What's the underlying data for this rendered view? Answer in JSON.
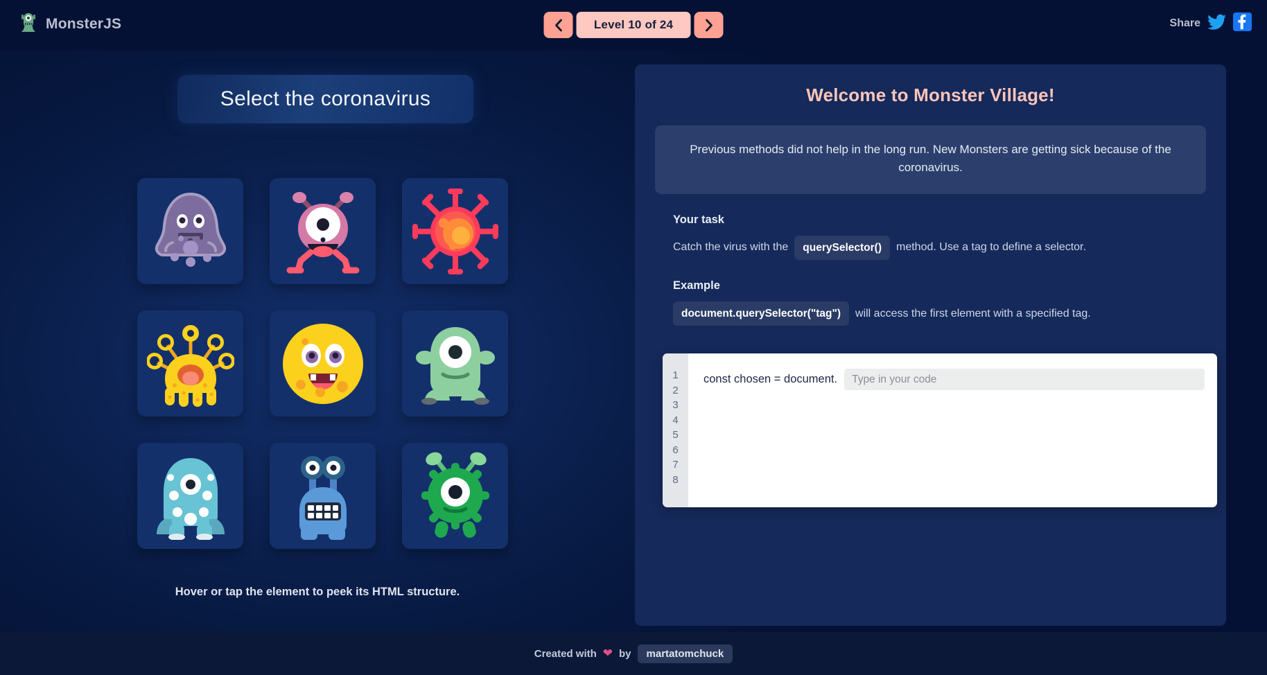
{
  "header": {
    "logo_text": "MonsterJS",
    "logo_icon": "monster-icon",
    "nav": {
      "prev_icon": "chevron-left-icon",
      "next_icon": "chevron-right-icon",
      "level_label": "Level 10 of 24",
      "current_level": 10,
      "total_levels": 24
    },
    "share": {
      "label": "Share",
      "twitter_icon": "twitter-icon",
      "facebook_icon": "facebook-icon"
    }
  },
  "left": {
    "task_title": "Select the coronavirus",
    "hint": "Hover or tap the element to peek its HTML structure.",
    "monsters": [
      {
        "name": "purple-blob-monster",
        "type": "monster"
      },
      {
        "name": "pink-cyclops-monster",
        "type": "monster"
      },
      {
        "name": "coronavirus",
        "type": "virus"
      },
      {
        "name": "yellow-stalk-eyes-monster",
        "type": "monster"
      },
      {
        "name": "yellow-round-monster",
        "type": "monster"
      },
      {
        "name": "green-cyclops-monster",
        "type": "monster"
      },
      {
        "name": "blue-many-eyes-monster",
        "type": "monster"
      },
      {
        "name": "blue-stalk-eyes-monster",
        "type": "monster"
      },
      {
        "name": "green-virus-monster",
        "type": "monster"
      }
    ]
  },
  "right": {
    "title": "Welcome to Monster Village!",
    "story": "Previous methods did not help in the long run. New Monsters are getting sick because of the coronavirus.",
    "task_heading": "Your task",
    "task_text_before": "Catch the virus with the",
    "task_code": "querySelector()",
    "task_text_after": "method. Use a tag to define a selector.",
    "example_heading": "Example",
    "example_code": "document.querySelector(\"tag\")",
    "example_text_after": "will access the first element with a specified tag.",
    "editor": {
      "line_numbers": [
        "1",
        "2",
        "3",
        "4",
        "5",
        "6",
        "7",
        "8"
      ],
      "code_prefix": "const chosen = document.",
      "input_value": "",
      "input_placeholder": "Type in your code"
    }
  },
  "footer": {
    "created_with": "Created with",
    "heart_icon": "heart-icon",
    "by": "by",
    "author": "martatomchuck"
  },
  "colors": {
    "bg": "#041134",
    "panel": "#15295a",
    "accent_pink": "#ffc5ba",
    "nav_button": "#ffa193",
    "level_box": "#ffc8c0",
    "cell": "#14306b",
    "virus_red": "#ff3b5c",
    "virus_orange": "#ff7a3d"
  }
}
